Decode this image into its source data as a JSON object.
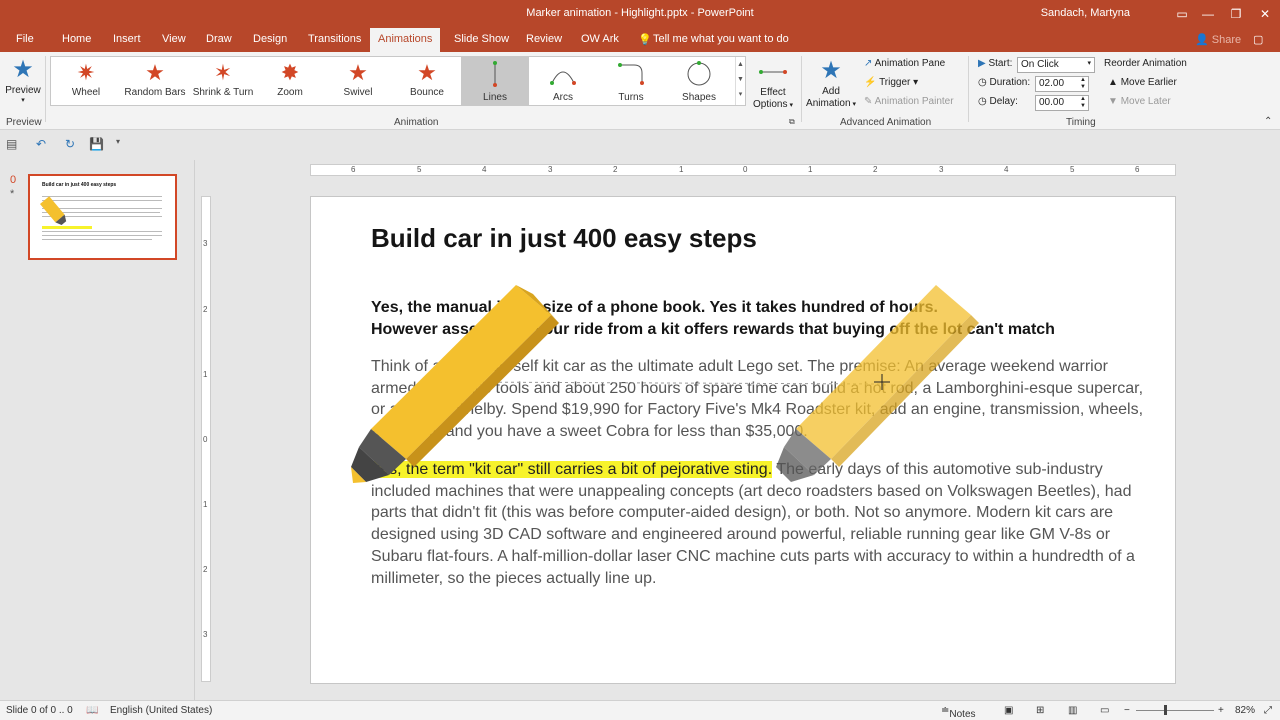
{
  "window": {
    "title": "Marker animation - Highlight.pptx  -  PowerPoint",
    "user": "Sandach, Martyna"
  },
  "tabs": [
    "File",
    "Home",
    "Insert",
    "View",
    "Draw",
    "Design",
    "Transitions",
    "Animations",
    "Slide Show",
    "Review",
    "OW Ark"
  ],
  "tell_me": "Tell me what you want to do",
  "share": "Share",
  "ribbon": {
    "preview_label": "Preview",
    "preview_group": "Preview",
    "animations": [
      "Wheel",
      "Random Bars",
      "Shrink & Turn",
      "Zoom",
      "Swivel",
      "Bounce",
      "Lines",
      "Arcs",
      "Turns",
      "Shapes"
    ],
    "selected_animation": "Lines",
    "effect_options": [
      "Effect",
      "Options"
    ],
    "animation_group": "Animation",
    "add_animation": [
      "Add",
      "Animation"
    ],
    "animation_pane": "Animation Pane",
    "trigger": "Trigger",
    "animation_painter": "Animation Painter",
    "advanced_group": "Advanced Animation",
    "start_label": "Start:",
    "start_value": "On Click",
    "duration_label": "Duration:",
    "duration_value": "02.00",
    "delay_label": "Delay:",
    "delay_value": "00.00",
    "timing_group": "Timing",
    "reorder_title": "Reorder Animation",
    "move_earlier": "Move Earlier",
    "move_later": "Move Later"
  },
  "thumb": {
    "number": "0",
    "star": "*",
    "title": "Build car in just 400 easy steps"
  },
  "ruler": {
    "h": [
      "6",
      "5",
      "4",
      "3",
      "2",
      "1",
      "0",
      "1",
      "2",
      "3",
      "4",
      "5",
      "6"
    ],
    "v": [
      "3",
      "2",
      "1",
      "0",
      "1",
      "2",
      "3"
    ]
  },
  "slide": {
    "title": "Build car in just 400 easy steps",
    "sub1": "Yes, the manual is the size of a phone book. Yes it takes hundred of hours.",
    "sub2": "However assembling your ride from a kit offers rewards that buying off the lot can't match",
    "p1": "Think of a do-it-yourself kit car as the ultimate adult Lego set. The premise: An average weekend warrior armed with basic tools and about 250 hours of spare time can build a hot rod, a Lamborghini-esque supercar, or a replica Shelby. Spend $19,990 for Factory Five's Mk4 Roadster kit, add an engine, transmission, wheels, and paint, and you have a sweet Cobra for less than $35,000.",
    "p2_highlight": "Yes, the term \"kit car\" still carries a bit of pejorative sting.",
    "p2_rest": " The early days of this automotive sub-industry included machines that were unappealing concepts (art deco roadsters based on Volkswagen Beetles), had parts that didn't fit (this was before computer-aided design), or both. Not so anymore. Modern kit cars are designed using 3D CAD software and engineered around powerful, reliable running gear like GM V-8s or Subaru flat-fours. A half-million-dollar laser CNC machine cuts parts with accuracy to within a hundredth of a millimeter, so the pieces actually line up."
  },
  "status": {
    "slide": "Slide 0 of 0 .. 0",
    "language": "English (United States)",
    "notes": "Notes",
    "zoom": "82%"
  },
  "colors": {
    "accent": "#b7472a",
    "highlight": "#f7f32b",
    "marker": "#f4c02e"
  }
}
